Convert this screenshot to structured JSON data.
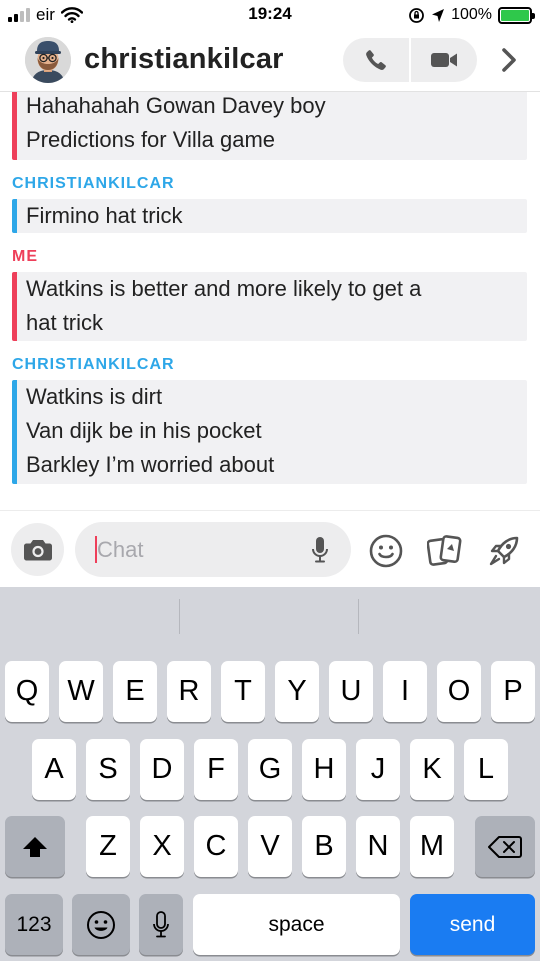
{
  "status_bar": {
    "carrier": "eir",
    "time": "19:24",
    "battery": "100%",
    "battery_level": 100
  },
  "header": {
    "title": "christiankilcar"
  },
  "conversation": [
    {
      "sender": "",
      "is_me": true,
      "lines": [
        "Hahahahah Gowan Davey boy",
        "Predictions for Villa game"
      ]
    },
    {
      "sender": "CHRISTIANKILCAR",
      "is_me": false,
      "lines": [
        "Firmino hat trick"
      ]
    },
    {
      "sender": "ME",
      "is_me": true,
      "lines": [
        "Watkins is better and more likely to get a",
        "hat trick"
      ]
    },
    {
      "sender": "CHRISTIANKILCAR",
      "is_me": false,
      "lines": [
        "Watkins is dirt",
        "Van dijk be in his pocket",
        "Barkley I’m worried about"
      ]
    }
  ],
  "input": {
    "placeholder": "Chat",
    "value": ""
  },
  "keyboard": {
    "row1": [
      "Q",
      "W",
      "E",
      "R",
      "T",
      "Y",
      "U",
      "I",
      "O",
      "P"
    ],
    "row2": [
      "A",
      "S",
      "D",
      "F",
      "G",
      "H",
      "J",
      "K",
      "L"
    ],
    "row3": [
      "Z",
      "X",
      "C",
      "V",
      "B",
      "N",
      "M"
    ],
    "numbers_label": "123",
    "space_label": "space",
    "send_label": "send"
  },
  "colors": {
    "them_accent": "#2ea7e8",
    "me_accent": "#ee3f5a",
    "send_key": "#1a7cf2",
    "battery_fill": "#2fc84b"
  },
  "icons": {
    "camera": "camera-icon",
    "microphone": "microphone-icon",
    "emoji": "smiley-icon",
    "stickers": "sticker-cards-icon",
    "games": "rocket-icon",
    "phone": "phone-icon",
    "video": "video-camera-icon",
    "chevron": "chevron-right-icon"
  }
}
